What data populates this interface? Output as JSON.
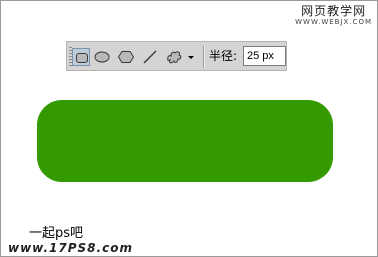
{
  "watermark_top": {
    "title": "网页教学网",
    "url": "WWW.WEBJX.COM"
  },
  "toolbar": {
    "tools": [
      {
        "icon": "rounded-rectangle-tool-icon",
        "active": true
      },
      {
        "icon": "ellipse-tool-icon",
        "active": false
      },
      {
        "icon": "polygon-tool-icon",
        "active": false
      },
      {
        "icon": "line-tool-icon",
        "active": false
      },
      {
        "icon": "custom-shape-tool-icon",
        "active": false
      },
      {
        "icon": "dropdown-arrow-icon",
        "active": false
      }
    ],
    "radius_label": "半径:",
    "radius_value": "25 px"
  },
  "canvas": {
    "shape_color": "#339a00"
  },
  "watermark_bottom": {
    "line1": "一起ps吧",
    "line2": "www.17PS8.com"
  }
}
